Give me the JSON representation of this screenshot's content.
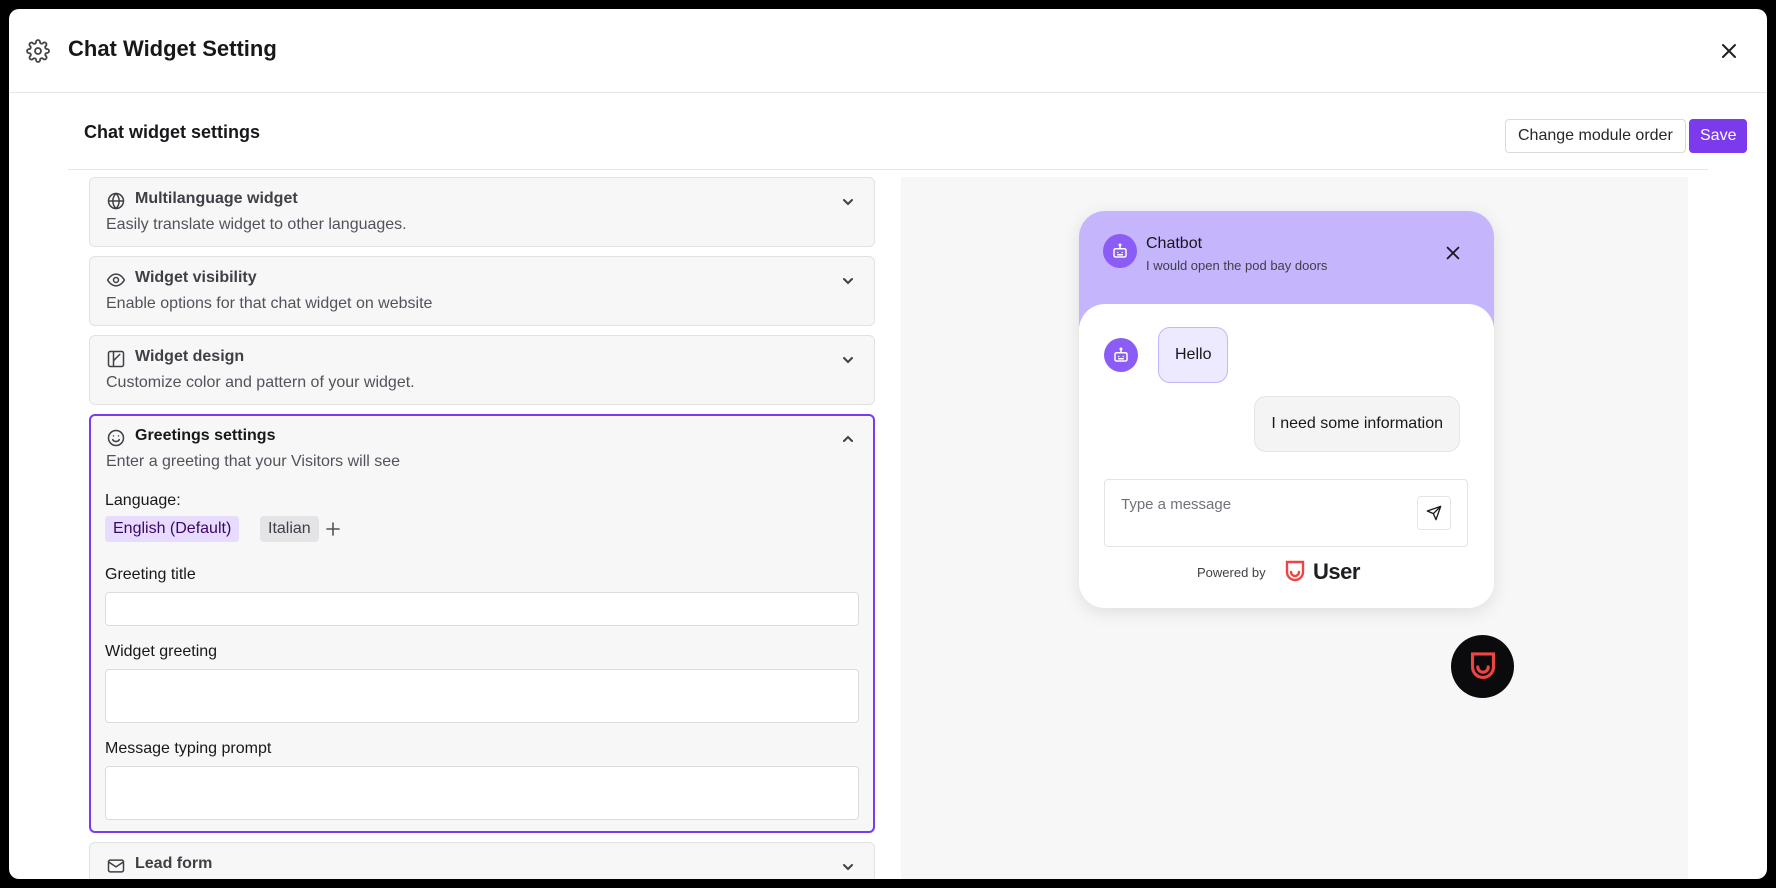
{
  "modal": {
    "title": "Chat Widget Setting"
  },
  "header": {
    "title": "Chat widget settings",
    "change_order_label": "Change module order",
    "save_label": "Save"
  },
  "sections": [
    {
      "title": "Multilanguage widget",
      "description": "Easily translate widget to other languages.",
      "icon": "globe-icon",
      "expanded": false
    },
    {
      "title": "Widget visibility",
      "description": "Enable options for that chat widget on website",
      "icon": "eye-icon",
      "expanded": false
    },
    {
      "title": "Widget design",
      "description": "Customize color and pattern of your widget.",
      "icon": "palette-icon",
      "expanded": false
    },
    {
      "title": "Greetings settings",
      "description": "Enter a greeting that your Visitors will see",
      "icon": "smile-icon",
      "expanded": true
    },
    {
      "title": "Lead form",
      "description": "",
      "icon": "mail-icon",
      "expanded": false
    }
  ],
  "greetings": {
    "language_label": "Language:",
    "languages": [
      "English (Default)",
      "Italian"
    ],
    "greeting_title_label": "Greeting title",
    "greeting_title_value": "",
    "widget_greeting_label": "Widget greeting",
    "widget_greeting_value": "",
    "typing_prompt_label": "Message typing prompt",
    "typing_prompt_value": ""
  },
  "preview": {
    "bot_name": "Chatbot",
    "bot_status": "I would open the pod bay doors",
    "messages": [
      {
        "from": "bot",
        "text": "Hello"
      },
      {
        "from": "user",
        "text": "I need some information"
      }
    ],
    "input_placeholder": "Type a message",
    "powered_by": "Powered by",
    "brand": "User"
  },
  "colors": {
    "accent": "#7c3aed",
    "chat_header": "#c4b5fd",
    "brand_logo": "#ef4444",
    "launcher_bg": "#0b0b0d"
  }
}
